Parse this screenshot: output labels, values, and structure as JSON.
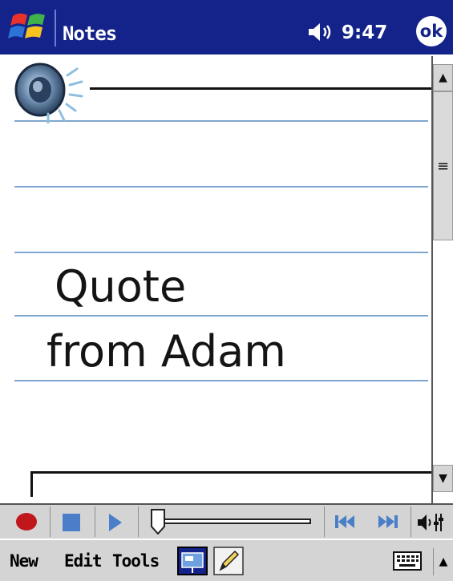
{
  "titlebar": {
    "app_title": "Notes",
    "clock": "9:47",
    "ok_label": "ok"
  },
  "note": {
    "ink_lines": [
      "Quote",
      "from Adam"
    ]
  },
  "menubar": {
    "items": [
      "New",
      "Edit",
      "Tools"
    ]
  },
  "colors": {
    "titlebar": "#14238a",
    "rule_lines": "#7ea6cf",
    "record": "#c0171d",
    "player_controls": "#4a7ec8",
    "chrome": "#d4d4d4"
  }
}
